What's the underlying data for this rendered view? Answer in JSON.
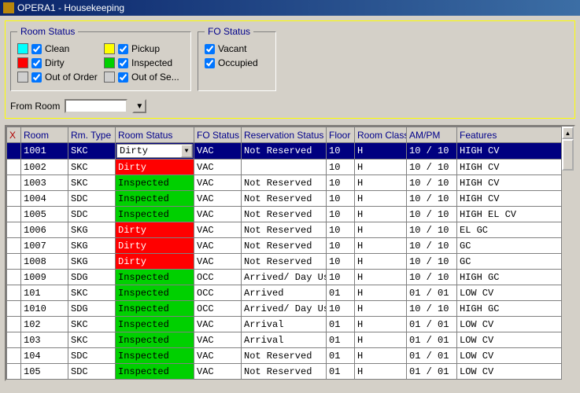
{
  "window": {
    "title": "OPERA1 - Housekeeping"
  },
  "panels": {
    "room_status": {
      "legend": "Room Status",
      "items": [
        {
          "color": "cyan",
          "checked": true,
          "label": "Clean"
        },
        {
          "color": "yellow",
          "checked": true,
          "label": "Pickup"
        },
        {
          "color": "red",
          "checked": true,
          "label": "Dirty"
        },
        {
          "color": "green",
          "checked": true,
          "label": "Inspected"
        },
        {
          "color": "gray",
          "checked": true,
          "label": "Out of Order"
        },
        {
          "color": "gray",
          "checked": true,
          "label": "Out of Se..."
        }
      ]
    },
    "fo_status": {
      "legend": "FO Status",
      "items": [
        {
          "checked": true,
          "label": "Vacant"
        },
        {
          "checked": true,
          "label": "Occupied"
        }
      ]
    }
  },
  "from_room": {
    "label": "From Room",
    "value": ""
  },
  "columns": {
    "x": "X",
    "room": "Room",
    "rm_type": "Rm. Type",
    "room_status": "Room Status",
    "fo_status": "FO Status",
    "reservation": "Reservation Status",
    "floor": "Floor",
    "room_class": "Room Class",
    "am_pm": "AM/PM",
    "features": "Features"
  },
  "rows": [
    {
      "room": "1001",
      "rm_type": "SKC",
      "room_status": "Dirty",
      "status_color": "drop",
      "fo": "VAC",
      "res": "Not Reserved",
      "floor": "10",
      "rc": "H",
      "am_pm": "10 / 10",
      "feat": "HIGH  CV",
      "sel": true
    },
    {
      "room": "1002",
      "rm_type": "SKC",
      "room_status": "Dirty",
      "status_color": "red",
      "fo": "VAC",
      "res": "",
      "floor": "10",
      "rc": "H",
      "am_pm": "10 / 10",
      "feat": "HIGH  CV"
    },
    {
      "room": "1003",
      "rm_type": "SKC",
      "room_status": "Inspected",
      "status_color": "green",
      "fo": "VAC",
      "res": "Not Reserved",
      "floor": "10",
      "rc": "H",
      "am_pm": "10 / 10",
      "feat": "HIGH  CV"
    },
    {
      "room": "1004",
      "rm_type": "SDC",
      "room_status": "Inspected",
      "status_color": "green",
      "fo": "VAC",
      "res": "Not Reserved",
      "floor": "10",
      "rc": "H",
      "am_pm": "10 / 10",
      "feat": "HIGH  CV"
    },
    {
      "room": "1005",
      "rm_type": "SDC",
      "room_status": "Inspected",
      "status_color": "green",
      "fo": "VAC",
      "res": "Not Reserved",
      "floor": "10",
      "rc": "H",
      "am_pm": "10 / 10",
      "feat": "HIGH  EL  CV"
    },
    {
      "room": "1006",
      "rm_type": "SKG",
      "room_status": "Dirty",
      "status_color": "red",
      "fo": "VAC",
      "res": "Not Reserved",
      "floor": "10",
      "rc": "H",
      "am_pm": "10 / 10",
      "feat": "EL  GC"
    },
    {
      "room": "1007",
      "rm_type": "SKG",
      "room_status": "Dirty",
      "status_color": "red",
      "fo": "VAC",
      "res": "Not Reserved",
      "floor": "10",
      "rc": "H",
      "am_pm": "10 / 10",
      "feat": "GC"
    },
    {
      "room": "1008",
      "rm_type": "SKG",
      "room_status": "Dirty",
      "status_color": "red",
      "fo": "VAC",
      "res": "Not Reserved",
      "floor": "10",
      "rc": "H",
      "am_pm": "10 / 10",
      "feat": "GC"
    },
    {
      "room": "1009",
      "rm_type": "SDG",
      "room_status": "Inspected",
      "status_color": "green",
      "fo": "OCC",
      "res": "Arrived/ Day Use/",
      "floor": "10",
      "rc": "H",
      "am_pm": "10 / 10",
      "feat": "HIGH  GC"
    },
    {
      "room": "101",
      "rm_type": "SKC",
      "room_status": "Inspected",
      "status_color": "green",
      "fo": "OCC",
      "res": "Arrived",
      "floor": "01",
      "rc": "H",
      "am_pm": "01 / 01",
      "feat": "LOW  CV"
    },
    {
      "room": "1010",
      "rm_type": "SDG",
      "room_status": "Inspected",
      "status_color": "green",
      "fo": "OCC",
      "res": "Arrived/ Day Use/",
      "floor": "10",
      "rc": "H",
      "am_pm": "10 / 10",
      "feat": "HIGH  GC"
    },
    {
      "room": "102",
      "rm_type": "SKC",
      "room_status": "Inspected",
      "status_color": "green",
      "fo": "VAC",
      "res": "Arrival",
      "floor": "01",
      "rc": "H",
      "am_pm": "01 / 01",
      "feat": "LOW  CV"
    },
    {
      "room": "103",
      "rm_type": "SKC",
      "room_status": "Inspected",
      "status_color": "green",
      "fo": "VAC",
      "res": "Arrival",
      "floor": "01",
      "rc": "H",
      "am_pm": "01 / 01",
      "feat": "LOW  CV"
    },
    {
      "room": "104",
      "rm_type": "SDC",
      "room_status": "Inspected",
      "status_color": "green",
      "fo": "VAC",
      "res": "Not Reserved",
      "floor": "01",
      "rc": "H",
      "am_pm": "01 / 01",
      "feat": "LOW  CV"
    },
    {
      "room": "105",
      "rm_type": "SDC",
      "room_status": "Inspected",
      "status_color": "green",
      "fo": "VAC",
      "res": "Not Reserved",
      "floor": "01",
      "rc": "H",
      "am_pm": "01 / 01",
      "feat": "LOW  CV"
    }
  ]
}
